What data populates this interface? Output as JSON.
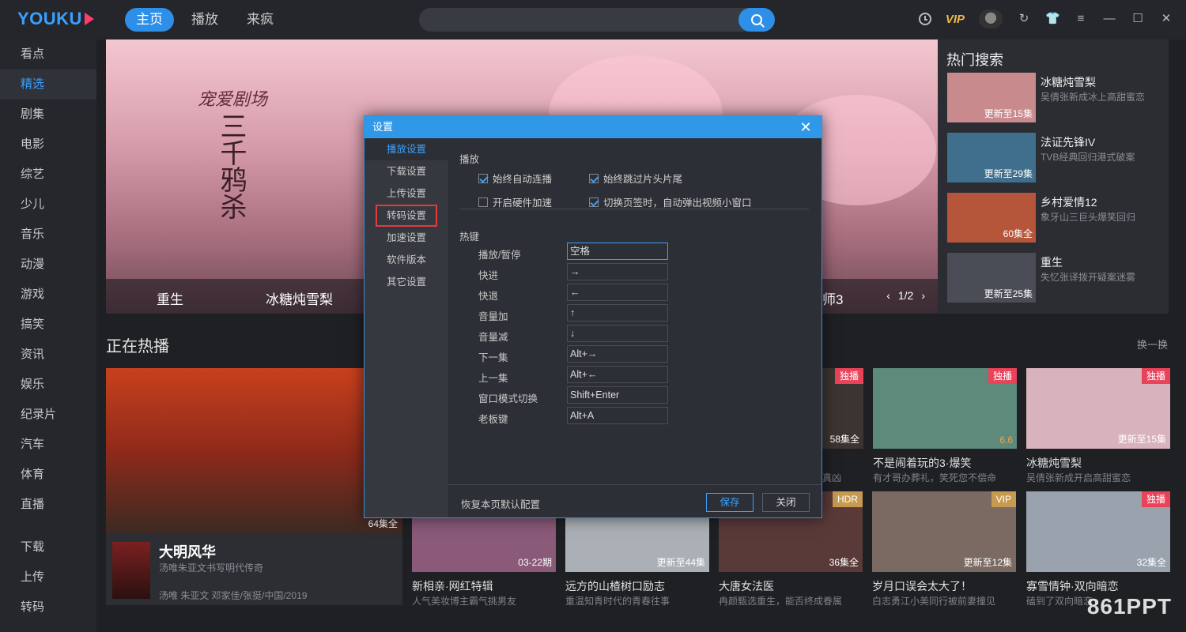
{
  "app": {
    "logo": "YOUKU"
  },
  "nav": {
    "tabs": [
      "主页",
      "播放",
      "来疯"
    ],
    "active": 0
  },
  "search": {
    "placeholder": ""
  },
  "top_right": {
    "vip": "VIP"
  },
  "sidebar": {
    "items": [
      "看点",
      "精选",
      "剧集",
      "电影",
      "综艺",
      "少儿",
      "音乐",
      "动漫",
      "游戏",
      "搞笑",
      "资讯",
      "娱乐",
      "纪录片",
      "汽车",
      "体育",
      "直播"
    ],
    "bottom_items": [
      "下载",
      "上传",
      "转码"
    ],
    "active": 1
  },
  "banner": {
    "calligraphy": "宠爱剧场",
    "big_title": "三千鸦杀",
    "strip_titles": [
      "重生",
      "冰糖炖雪梨",
      "师3"
    ],
    "pager": "1/2"
  },
  "hot_search": {
    "title": "热门搜索",
    "items": [
      {
        "title": "冰糖炖雪梨",
        "sub": "吴倩张新成冰上高甜蜜恋",
        "cap": "更新至15集",
        "color": "#c98a8e"
      },
      {
        "title": "法证先锋IV",
        "sub": "TVB经典回归港式破案",
        "cap": "更新至29集",
        "color": "#3f6f8c"
      },
      {
        "title": "乡村爱情12",
        "sub": "象牙山三巨头爆笑回归",
        "cap": "60集全",
        "color": "#b5553a"
      },
      {
        "title": "重生",
        "sub": "失忆张译拨开疑案迷雾",
        "cap": "更新至25集",
        "color": "#4a4d55"
      }
    ]
  },
  "section": {
    "title": "正在热播",
    "refresh": "换一换"
  },
  "feature": {
    "title": "大明风华",
    "sub": "汤唯朱亚文书写明代传奇",
    "cast": "汤唯 朱亚文 邓家佳/张挺/中国/2019",
    "cap": "64集全"
  },
  "cards_row1": [
    {
      "badge": "独播",
      "cap": "58集全",
      "title": "",
      "sub": "真凶",
      "color": "#3b3431"
    },
    {
      "badge": "独播",
      "score": "6.6",
      "title": "不是闹着玩的3·爆笑",
      "sub": "有才哥办葬礼，笑死您不偿命",
      "color": "#5e8a7c"
    },
    {
      "badge": "独播",
      "cap": "更新至15集",
      "title": "冰糖炖雪梨",
      "sub": "吴倩张新成开启高甜蜜恋",
      "color": "#d8b2bc"
    }
  ],
  "cards_row2": [
    {
      "cap": "03-22期",
      "title": "新相亲·网红特辑",
      "sub": "人气美妆博主霸气挑男友",
      "color": "#8a5a78"
    },
    {
      "cap": "更新至44集",
      "title": "远方的山楂树口励志",
      "sub": "重温知青时代的青春往事",
      "color": "#aab0b5"
    },
    {
      "badge": "HDR",
      "cap": "36集全",
      "title": "大唐女法医",
      "sub": "冉颜甄选重生，能否终成眷属",
      "color": "#5a3a38"
    },
    {
      "badge": "VIP",
      "cap": "更新至12集",
      "title": "岁月口误会太大了！",
      "sub": "白志勇江小美同行被前妻撞见",
      "color": "#7a6a62"
    },
    {
      "badge": "独播",
      "cap": "32集全",
      "title": "寡雪情钟·双向暗恋",
      "sub": "磕到了双向暗恋",
      "color": "#9aa3ad"
    }
  ],
  "watermark": "861PPT",
  "dialog": {
    "title": "设置",
    "nav": [
      "播放设置",
      "下载设置",
      "上传设置",
      "转码设置",
      "加速设置",
      "软件版本",
      "其它设置"
    ],
    "active_nav": 0,
    "highlighted_nav": 3,
    "play_group": "播放",
    "checks": [
      {
        "label": "始终自动连播",
        "checked": true
      },
      {
        "label": "始终跳过片头片尾",
        "checked": true
      },
      {
        "label": "开启硬件加速",
        "checked": false
      },
      {
        "label": "切换页签时，自动弹出视频小窗口",
        "checked": true
      }
    ],
    "hotkey_group": "热键",
    "hotkeys": [
      {
        "label": "播放/暂停",
        "value": "空格"
      },
      {
        "label": "快进",
        "value": "→"
      },
      {
        "label": "快退",
        "value": "←"
      },
      {
        "label": "音量加",
        "value": "↑"
      },
      {
        "label": "音量减",
        "value": "↓"
      },
      {
        "label": "下一集",
        "value": "Alt+→"
      },
      {
        "label": "上一集",
        "value": "Alt+←"
      },
      {
        "label": "窗口模式切换",
        "value": "Shift+Enter"
      },
      {
        "label": "老板键",
        "value": "Alt+A"
      }
    ],
    "reset": "恢复本页默认配置",
    "save": "保存",
    "close": "关闭"
  }
}
